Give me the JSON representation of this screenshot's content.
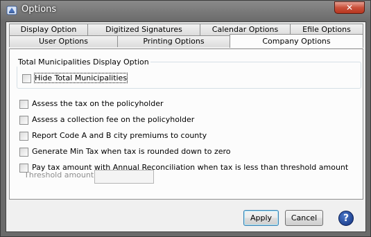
{
  "window": {
    "title": "Options",
    "close_glyph": "✕"
  },
  "tabs_row1": [
    {
      "label": "Display Option"
    },
    {
      "label": "Digitized Signatures"
    },
    {
      "label": "Calendar Options"
    },
    {
      "label": "Efile Options"
    }
  ],
  "tabs_row2": [
    {
      "label": "User Options"
    },
    {
      "label": "Printing Options"
    },
    {
      "label": "Company Options",
      "active": true
    }
  ],
  "group": {
    "title": "Total Municipalities Display Option",
    "checkbox_label": "Hide Total Municipalities",
    "checked": false
  },
  "options": [
    {
      "label": "Assess the tax on the policyholder",
      "checked": false
    },
    {
      "label": "Assess a collection fee on the policyholder",
      "checked": false
    },
    {
      "label": "Report Code A and B city premiums to county",
      "checked": false
    },
    {
      "label": "Generate Min Tax when tax is rounded down to zero",
      "checked": false
    },
    {
      "label": "Pay tax amount with Annual Reconciliation when tax is less than threshold amount",
      "checked": false
    }
  ],
  "threshold": {
    "label": "Threshold amount",
    "value": ""
  },
  "buttons": {
    "apply": "Apply",
    "cancel": "Cancel",
    "help_glyph": "?"
  }
}
